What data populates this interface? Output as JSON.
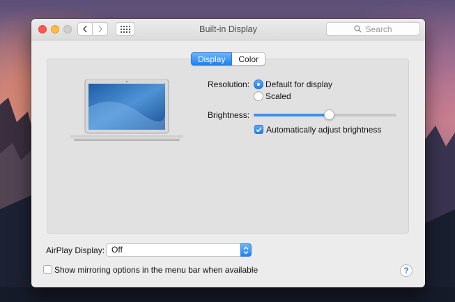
{
  "window": {
    "title": "Built-in Display",
    "search_placeholder": "Search"
  },
  "tabs": [
    {
      "label": "Display",
      "selected": true
    },
    {
      "label": "Color",
      "selected": false
    }
  ],
  "display": {
    "resolution_label": "Resolution:",
    "resolution_options": [
      {
        "label": "Default for display",
        "selected": true
      },
      {
        "label": "Scaled",
        "selected": false
      }
    ],
    "brightness_label": "Brightness:",
    "brightness_level": 0.53,
    "auto_brightness_label": "Automatically adjust brightness",
    "auto_brightness_checked": true
  },
  "airplay": {
    "label": "AirPlay Display:",
    "selected_value": "Off"
  },
  "mirroring": {
    "label": "Show mirroring options in the menu bar when available",
    "checked": false
  },
  "help_label": "?",
  "colors": {
    "accent": "#1e82f2",
    "close": "#fc5753",
    "minimize": "#fdbc40",
    "zoom_disabled": "#cfcfcf"
  }
}
